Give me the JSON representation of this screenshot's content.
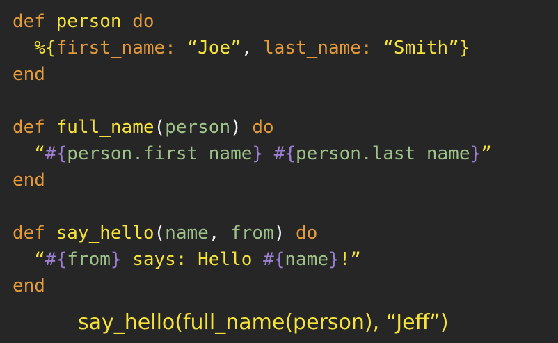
{
  "code": {
    "l1": {
      "def": "def",
      "name": "person",
      "do": "do"
    },
    "l2": {
      "indent": "  ",
      "open": "%{",
      "k1": "first_name:",
      "v1": "“Joe”",
      "comma": ", ",
      "k2": "last_name:",
      "v2": "“Smith”",
      "close": "}"
    },
    "l3": {
      "end": "end"
    },
    "l4": {
      "def": "def",
      "name": "full_name",
      "lp": "(",
      "param": "person",
      "rp": ")",
      "do": "do"
    },
    "l5": {
      "indent": "  ",
      "q1": "“",
      "i1o": "#{",
      "e1": "person.first_name",
      "i1c": "}",
      "sp": " ",
      "i2o": "#{",
      "e2": "person.last_name",
      "i2c": "}",
      "q2": "”"
    },
    "l6": {
      "end": "end"
    },
    "l7": {
      "def": "def",
      "name": "say_hello",
      "lp": "(",
      "p1": "name",
      "comma": ", ",
      "p2": "from",
      "rp": ")",
      "do": "do"
    },
    "l8": {
      "indent": "  ",
      "q1": "“",
      "i1o": "#{",
      "e1": "from",
      "i1c": "}",
      "mid": " says: Hello ",
      "i2o": "#{",
      "e2": "name",
      "i2c": "}",
      "tail": "!”"
    },
    "l9": {
      "end": "end"
    }
  },
  "usage": {
    "fn": "say_hello",
    "lp": "(",
    "inner": "full_name",
    "lp2": "(",
    "arg": "person",
    "rp2": ")",
    "comma": ", ",
    "str": "“Jeff”",
    "rp": ")"
  },
  "colors": {
    "background": "#262626",
    "keyword": "#e39a3b",
    "function": "#f5e33a",
    "string": "#f5e33a",
    "variable": "#9ec28a",
    "interpolation": "#9b7fd0",
    "punctuation": "#f2f2f2"
  }
}
